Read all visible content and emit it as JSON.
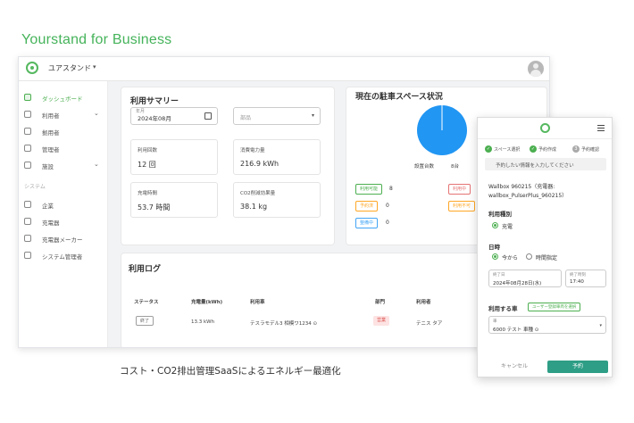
{
  "brand": {
    "title": "Yourstand for Business"
  },
  "topbar": {
    "app_name": "ユアスタンド",
    "caret": "▾"
  },
  "sidebar": {
    "items": [
      {
        "label": "ダッシュボード"
      },
      {
        "label": "利用者"
      },
      {
        "label": "拠用者"
      },
      {
        "label": "管理者"
      },
      {
        "label": "施設"
      }
    ],
    "section_label": "システム",
    "system_items": [
      {
        "label": "企業"
      },
      {
        "label": "充電器"
      },
      {
        "label": "充電器メーカー"
      },
      {
        "label": "システム管理者"
      }
    ]
  },
  "summary": {
    "title": "利用サマリー",
    "month_label": "年月",
    "month_value": "2024年08月",
    "dept_placeholder": "部品",
    "stats": [
      {
        "label": "利用回数",
        "value": "12 回"
      },
      {
        "label": "消費電力量",
        "value": "216.9 kWh"
      },
      {
        "label": "充電時間",
        "value": "53.7 時間"
      },
      {
        "label": "CO2削減効果量",
        "value": "38.1 kg"
      }
    ]
  },
  "parking": {
    "title": "現在の駐車スペース状況",
    "total_label": "設置台数",
    "total_value": "8台",
    "badges": [
      {
        "label": "利用可能",
        "value": "8",
        "color": "#4caf50"
      },
      {
        "label": "利用中",
        "value": "0",
        "color": "#e57373"
      },
      {
        "label": "予約済",
        "value": "0",
        "color": "#ffa726"
      },
      {
        "label": "利用不可",
        "value": "0",
        "color": "#ffa726"
      },
      {
        "label": "整備中",
        "value": "0",
        "color": "#42a5f5"
      }
    ],
    "pie_color": "#2196f3"
  },
  "log": {
    "title": "利用ログ",
    "headers": [
      "ステータス",
      "充電量(kWh)",
      "利用車",
      "部門",
      "利用者"
    ],
    "row": {
      "status": "終了",
      "kwh": "13.3 kWh",
      "car": "テスラモデル3 相模ワ1234 ⊙",
      "dept": "営業",
      "user": "テニス タア"
    }
  },
  "caption": "コスト・CO2排出管理SaaSによるエネルギー最適化",
  "mobile": {
    "steps": [
      "スペース選択",
      "予約作成",
      "予約確認"
    ],
    "instruction": "予約したい情報を入力してください",
    "device_line1": "Wallbox 960215（充電器:",
    "device_line2": "wallbox_PulserPlus_960215）",
    "usage_type_label": "利用種別",
    "usage_type_value": "充電",
    "time_label": "日時",
    "time_opt_now": "今から",
    "time_opt_specified": "時間指定",
    "date_label": "終了日",
    "date_value": "2024年08月28日(水)",
    "end_time_label": "終了時刻",
    "end_time_value": "17:40",
    "car_label": "利用する車",
    "car_link": "ユーザー登録車両を選択",
    "car_field_label": "車",
    "car_field_value": "6000 テスト 車種 ⊙",
    "cancel_label": "キャンセル",
    "submit_label": "予約"
  }
}
